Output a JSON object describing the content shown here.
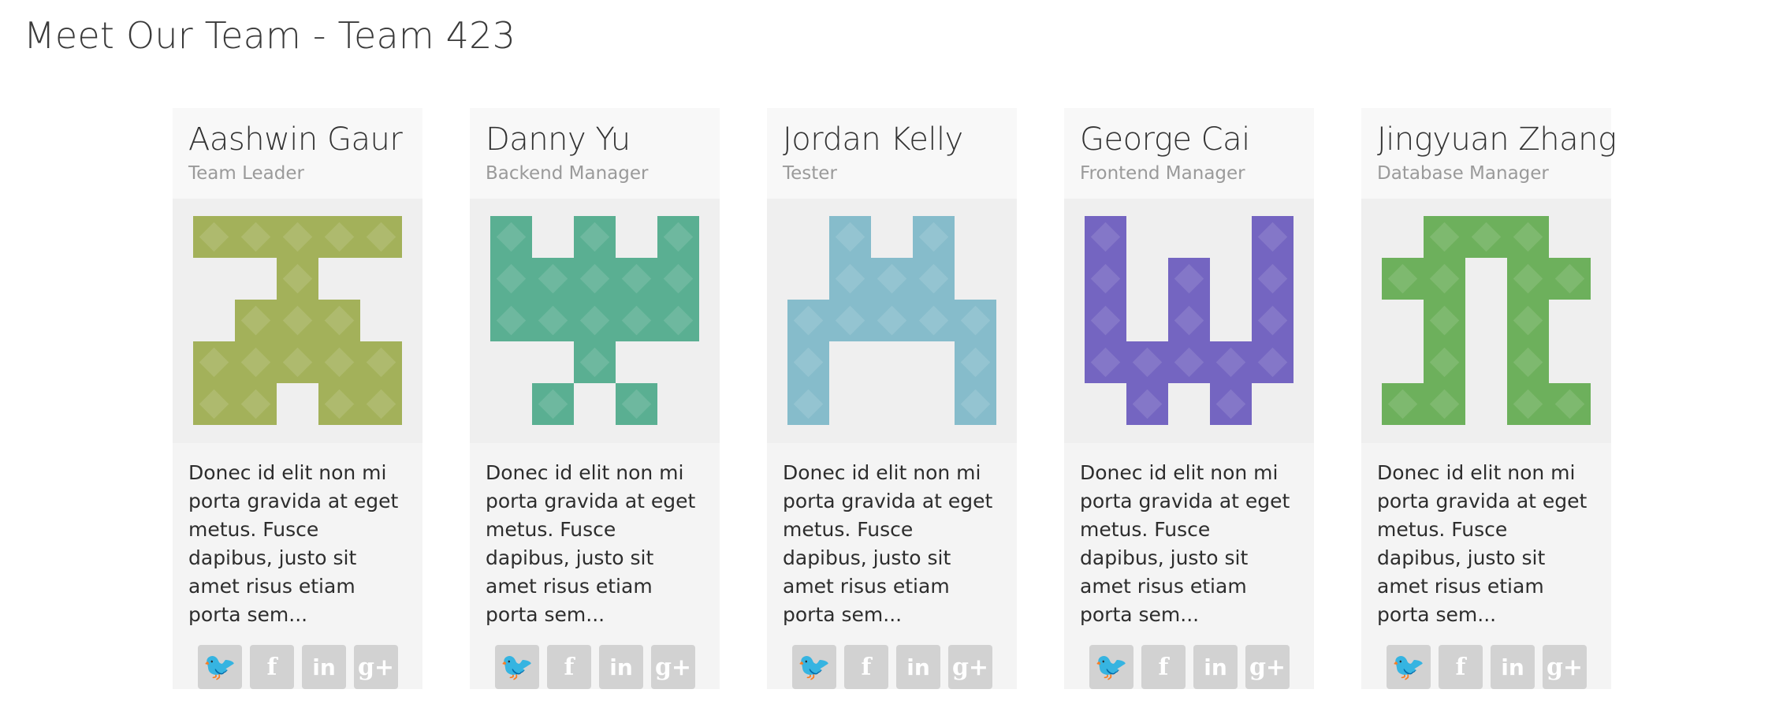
{
  "page": {
    "title": "Meet Our Team - Team 423"
  },
  "social_icons": [
    {
      "name": "twitter-icon",
      "glyph": "🐦"
    },
    {
      "name": "facebook-icon",
      "glyph": "f"
    },
    {
      "name": "linkedin-icon",
      "glyph": "in"
    },
    {
      "name": "google-plus-icon",
      "glyph": "g+"
    }
  ],
  "members": [
    {
      "name": "Aashwin Gaur",
      "role": "Team Leader",
      "bio": "Donec id elit non mi porta gravida at eget metus. Fusce dapibus, justo sit amet risus etiam porta sem...",
      "avatar_color": "#a3b15a",
      "avatar_pattern": [
        "11111",
        "00100",
        "01110",
        "11111",
        "11011"
      ]
    },
    {
      "name": "Danny Yu",
      "role": "Backend Manager",
      "bio": "Donec id elit non mi porta gravida at eget metus. Fusce dapibus, justo sit amet risus etiam porta sem...",
      "avatar_color": "#5aaf92",
      "avatar_pattern": [
        "10101",
        "11111",
        "11111",
        "00100",
        "01010"
      ]
    },
    {
      "name": "Jordan Kelly",
      "role": "Tester",
      "bio": "Donec id elit non mi porta gravida at eget metus. Fusce dapibus, justo sit amet risus etiam porta sem...",
      "avatar_color": "#86bccb",
      "avatar_pattern": [
        "01010",
        "01110",
        "11111",
        "10001",
        "10001"
      ]
    },
    {
      "name": "George Cai",
      "role": "Frontend Manager",
      "bio": "Donec id elit non mi porta gravida at eget metus. Fusce dapibus, justo sit amet risus etiam porta sem...",
      "avatar_color": "#7465c1",
      "avatar_pattern": [
        "10001",
        "10101",
        "10101",
        "11111",
        "01010"
      ]
    },
    {
      "name": "Jingyuan Zhang",
      "role": "Database Manager",
      "bio": "Donec id elit non mi porta gravida at eget metus. Fusce dapibus, justo sit amet risus etiam porta sem...",
      "avatar_color": "#6db05c",
      "avatar_pattern": [
        "01110",
        "11011",
        "01010",
        "01010",
        "11011"
      ]
    }
  ]
}
